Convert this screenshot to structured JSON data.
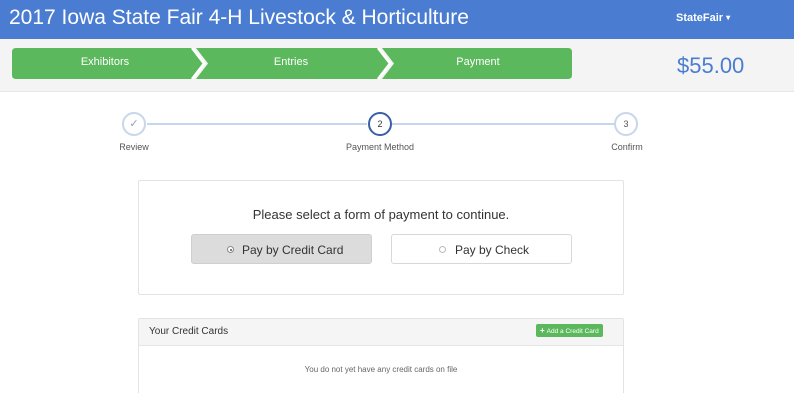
{
  "header": {
    "title": "2017 Iowa State Fair 4-H Livestock & Horticulture",
    "user_menu": "StateFair",
    "user_menu_caret": "▾",
    "background_color": "#4a7dd1"
  },
  "stepbar": {
    "steps": [
      {
        "label": "Exhibitors"
      },
      {
        "label": "Entries"
      },
      {
        "label": "Payment"
      }
    ],
    "color": "#5cb85c",
    "total": "$55.00"
  },
  "progress": {
    "steps": [
      {
        "number": "✓",
        "label": "Review",
        "state": "done"
      },
      {
        "number": "2",
        "label": "Payment Method",
        "state": "active"
      },
      {
        "number": "3",
        "label": "Confirm",
        "state": "pending"
      }
    ]
  },
  "payment": {
    "prompt": "Please select a form of payment to continue.",
    "options": [
      {
        "label": "Pay by Credit Card",
        "selected": true
      },
      {
        "label": "Pay by Check",
        "selected": false
      }
    ]
  },
  "credit_cards": {
    "title": "Your Credit Cards",
    "add_button_icon": "+",
    "add_button": "Add a Credit Card",
    "empty_message": "You do not yet have any credit cards on file"
  }
}
